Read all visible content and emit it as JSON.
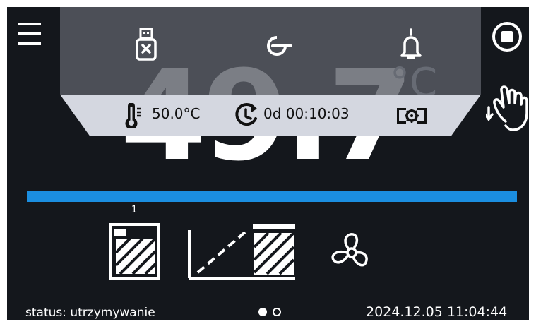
{
  "display": {
    "temperature": "49.7",
    "unit": "°C"
  },
  "top_panel": {
    "icons": [
      "usb-drive-removed-icon",
      "key-icon",
      "bell-icon"
    ]
  },
  "info_bar": {
    "setpoint": "50.0°C",
    "timer": "0d 00:10:03",
    "setpoint_icon": "thermometer-icon",
    "timer_icon": "clock-refresh-icon",
    "mode_icon": "camera-gear-icon"
  },
  "program": {
    "segment_number": "1",
    "progress": 1.0,
    "progress_color": "#1b8ee0"
  },
  "status_bar": {
    "status": "status: utrzymywanie",
    "datetime": "2024.12.05  11:04:44",
    "current_page": 1,
    "page_count": 2
  },
  "colors": {
    "background": "#14171c",
    "info_bar": "#d4d7e0",
    "accent": "#1b8ee0"
  }
}
